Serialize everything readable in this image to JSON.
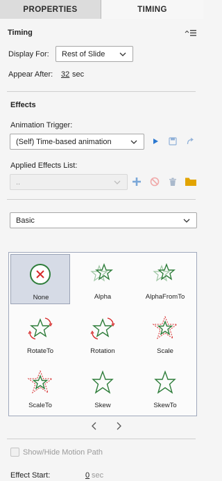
{
  "tabs": {
    "properties": "PROPERTIES",
    "timing": "TIMING"
  },
  "timing": {
    "title": "Timing",
    "menu_icon": "panel-menu-icon",
    "display_for_label": "Display For:",
    "display_for_value": "Rest of Slide",
    "appear_after_label": "Appear After:",
    "appear_after_value": "32",
    "appear_after_unit": "sec"
  },
  "effects": {
    "title": "Effects",
    "trigger_label": "Animation Trigger:",
    "trigger_value": "(Self) Time-based animation",
    "applied_label": "Applied Effects List:",
    "applied_value": "..",
    "category_value": "Basic",
    "items": [
      {
        "label": "None",
        "icon": "none-icon",
        "selected": true
      },
      {
        "label": "Alpha",
        "icon": "alpha-star-icon"
      },
      {
        "label": "AlphaFromTo",
        "icon": "alpha-from-to-star-icon"
      },
      {
        "label": "RotateTo",
        "icon": "rotate-to-star-icon"
      },
      {
        "label": "Rotation",
        "icon": "rotation-star-icon"
      },
      {
        "label": "Scale",
        "icon": "scale-star-icon"
      },
      {
        "label": "ScaleTo",
        "icon": "scale-to-star-icon"
      },
      {
        "label": "Skew",
        "icon": "skew-star-icon"
      },
      {
        "label": "SkewTo",
        "icon": "skew-to-star-icon"
      }
    ]
  },
  "motion_path_label": "Show/Hide Motion Path",
  "effect_start": {
    "label": "Effect Start:",
    "value": "0",
    "unit": "sec"
  },
  "colors": {
    "accent_blue": "#2b78d0",
    "star_green": "#2e7d3a",
    "arrow_red": "#d62a2a",
    "folder_yellow": "#e2a400"
  }
}
